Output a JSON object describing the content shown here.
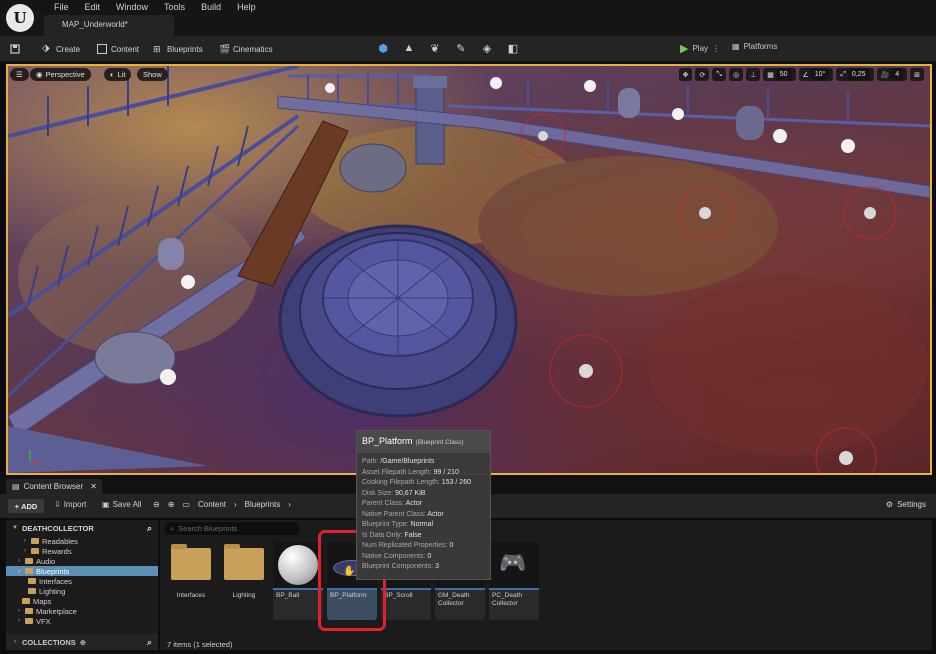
{
  "app": {
    "logo_letter": "U",
    "menus": [
      "File",
      "Edit",
      "Window",
      "Tools",
      "Build",
      "Help"
    ],
    "document_tab": "MAP_Underworld*"
  },
  "toolbar": {
    "create": "Create",
    "content": "Content",
    "blueprints": "Blueprints",
    "cinematics": "Cinematics",
    "play": "Play",
    "platforms": "Platforms"
  },
  "viewport": {
    "menu_icon": "hamburger-icon",
    "perspective": "Perspective",
    "lit": "Lit",
    "show": "Show",
    "grid_snap": "50",
    "rotation_snap": "10°",
    "scale_snap": "0,25",
    "camera_speed": "4"
  },
  "content_browser": {
    "tab_label": "Content Browser",
    "add": "ADD",
    "import": "Import",
    "save_all": "Save All",
    "breadcrumb": [
      "Content",
      "Blueprints"
    ],
    "settings": "Settings",
    "search_placeholder": "Search Blueprints",
    "tree_root": "DEATHCOLLECTOR",
    "tree": [
      {
        "label": "Readables",
        "level": 2
      },
      {
        "label": "Rewards",
        "level": 2
      },
      {
        "label": "Audio",
        "level": 1
      },
      {
        "label": "Blueprints",
        "level": 1,
        "selected": true
      },
      {
        "label": "Interfaces",
        "level": 2
      },
      {
        "label": "Lighting",
        "level": 2
      },
      {
        "label": "Maps",
        "level": 1
      },
      {
        "label": "Marketplace",
        "level": 1
      },
      {
        "label": "VFX",
        "level": 1
      }
    ],
    "collections": "COLLECTIONS",
    "assets": [
      {
        "label": "Interfaces",
        "kind": "folder"
      },
      {
        "label": "Lighting",
        "kind": "folder"
      },
      {
        "label": "BP_Ball",
        "kind": "blueprint"
      },
      {
        "label": "BP_Platform",
        "kind": "blueprint",
        "selected": true
      },
      {
        "label": "BP_Scroll",
        "kind": "blueprint"
      },
      {
        "label": "GM_Death Collector",
        "kind": "blueprint"
      },
      {
        "label": "PC_Death Collector",
        "kind": "blueprint"
      }
    ],
    "status": "7 items (1 selected)"
  },
  "tooltip": {
    "title": "BP_Platform",
    "subtitle": "(Blueprint Class)",
    "rows": [
      {
        "key": "Path:",
        "value": "/Game/Blueprints"
      },
      {
        "key": "Asset Filepath Length:",
        "value": "99 / 210"
      },
      {
        "key": "Cooking Filepath Length:",
        "value": "153 / 260"
      },
      {
        "key": "Disk Size:",
        "value": "90,67 KiB"
      },
      {
        "key": "Parent Class:",
        "value": "Actor"
      },
      {
        "key": "Native Parent Class:",
        "value": "Actor"
      },
      {
        "key": "Blueprint Type:",
        "value": "Normal"
      },
      {
        "key": "Is Data Only:",
        "value": "False"
      },
      {
        "key": "Num Replicated Properties:",
        "value": "0"
      },
      {
        "key": "Native Components:",
        "value": "0"
      },
      {
        "key": "Blueprint Components:",
        "value": "3"
      }
    ]
  },
  "colors": {
    "accent_blue": "#5a8fb8",
    "viewport_border": "#e6b23a",
    "highlight_red": "#e0202a",
    "play_green": "#6ecf4b"
  }
}
